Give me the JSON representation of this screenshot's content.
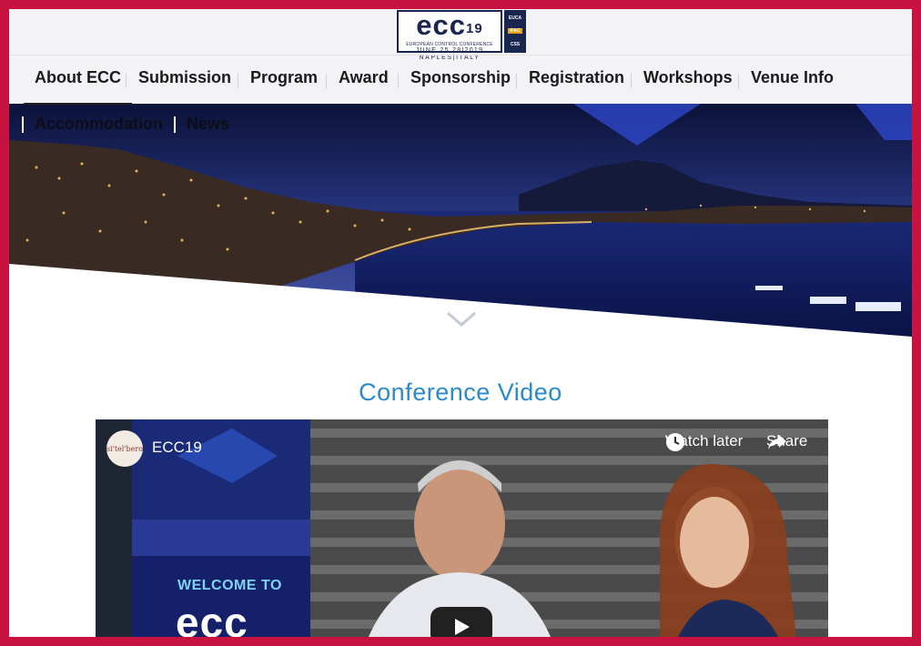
{
  "logo": {
    "mark": "ecc",
    "mark_num": "19",
    "sub": "EUROPEAN CONTROL CONFERENCE",
    "date": "JUNE 25 28|2019",
    "place": "NAPLES|ITALY",
    "sponsors": [
      "EUCA",
      "IFAC",
      "CSS"
    ]
  },
  "nav": {
    "items": [
      "About ECC",
      "Submission",
      "Program",
      "Award",
      "Sponsorship",
      "Registration",
      "Workshops",
      "Venue Info"
    ],
    "active": "About ECC"
  },
  "subnav": {
    "items": [
      "Accommodation",
      "News"
    ]
  },
  "section": {
    "title": "Conference Video"
  },
  "video": {
    "channel_logo": "si'tel'bero",
    "title": "ECC19",
    "watch_later": "Watch later",
    "share": "Share",
    "banner_welcome": "WELCOME TO",
    "banner_logo": "ecc"
  },
  "colors": {
    "border": "#c8123f",
    "accent_title": "#2a8bc8",
    "header_bg": "#f3f3f5"
  },
  "icons": [
    "chevron-down-icon",
    "clock-icon",
    "share-icon",
    "play-icon"
  ]
}
